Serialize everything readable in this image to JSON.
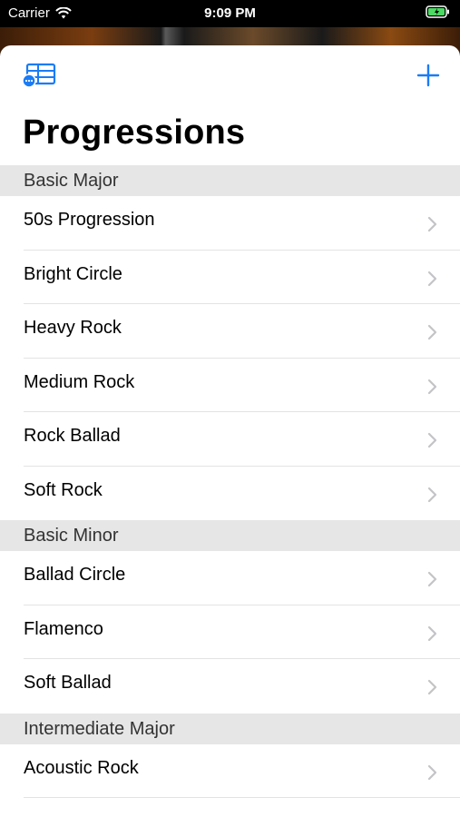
{
  "status_bar": {
    "carrier": "Carrier",
    "time": "9:09 PM"
  },
  "header": {
    "title": "Progressions"
  },
  "icons": {
    "left": "table-icon",
    "right": "plus-icon"
  },
  "colors": {
    "accent": "#1a7cf5"
  },
  "sections": [
    {
      "title": "Basic Major",
      "items": [
        "50s Progression",
        "Bright Circle",
        "Heavy Rock",
        "Medium Rock",
        "Rock Ballad",
        "Soft Rock"
      ]
    },
    {
      "title": "Basic Minor",
      "items": [
        "Ballad Circle",
        "Flamenco",
        "Soft Ballad"
      ]
    },
    {
      "title": "Intermediate Major",
      "items": [
        "Acoustic Rock"
      ]
    }
  ]
}
